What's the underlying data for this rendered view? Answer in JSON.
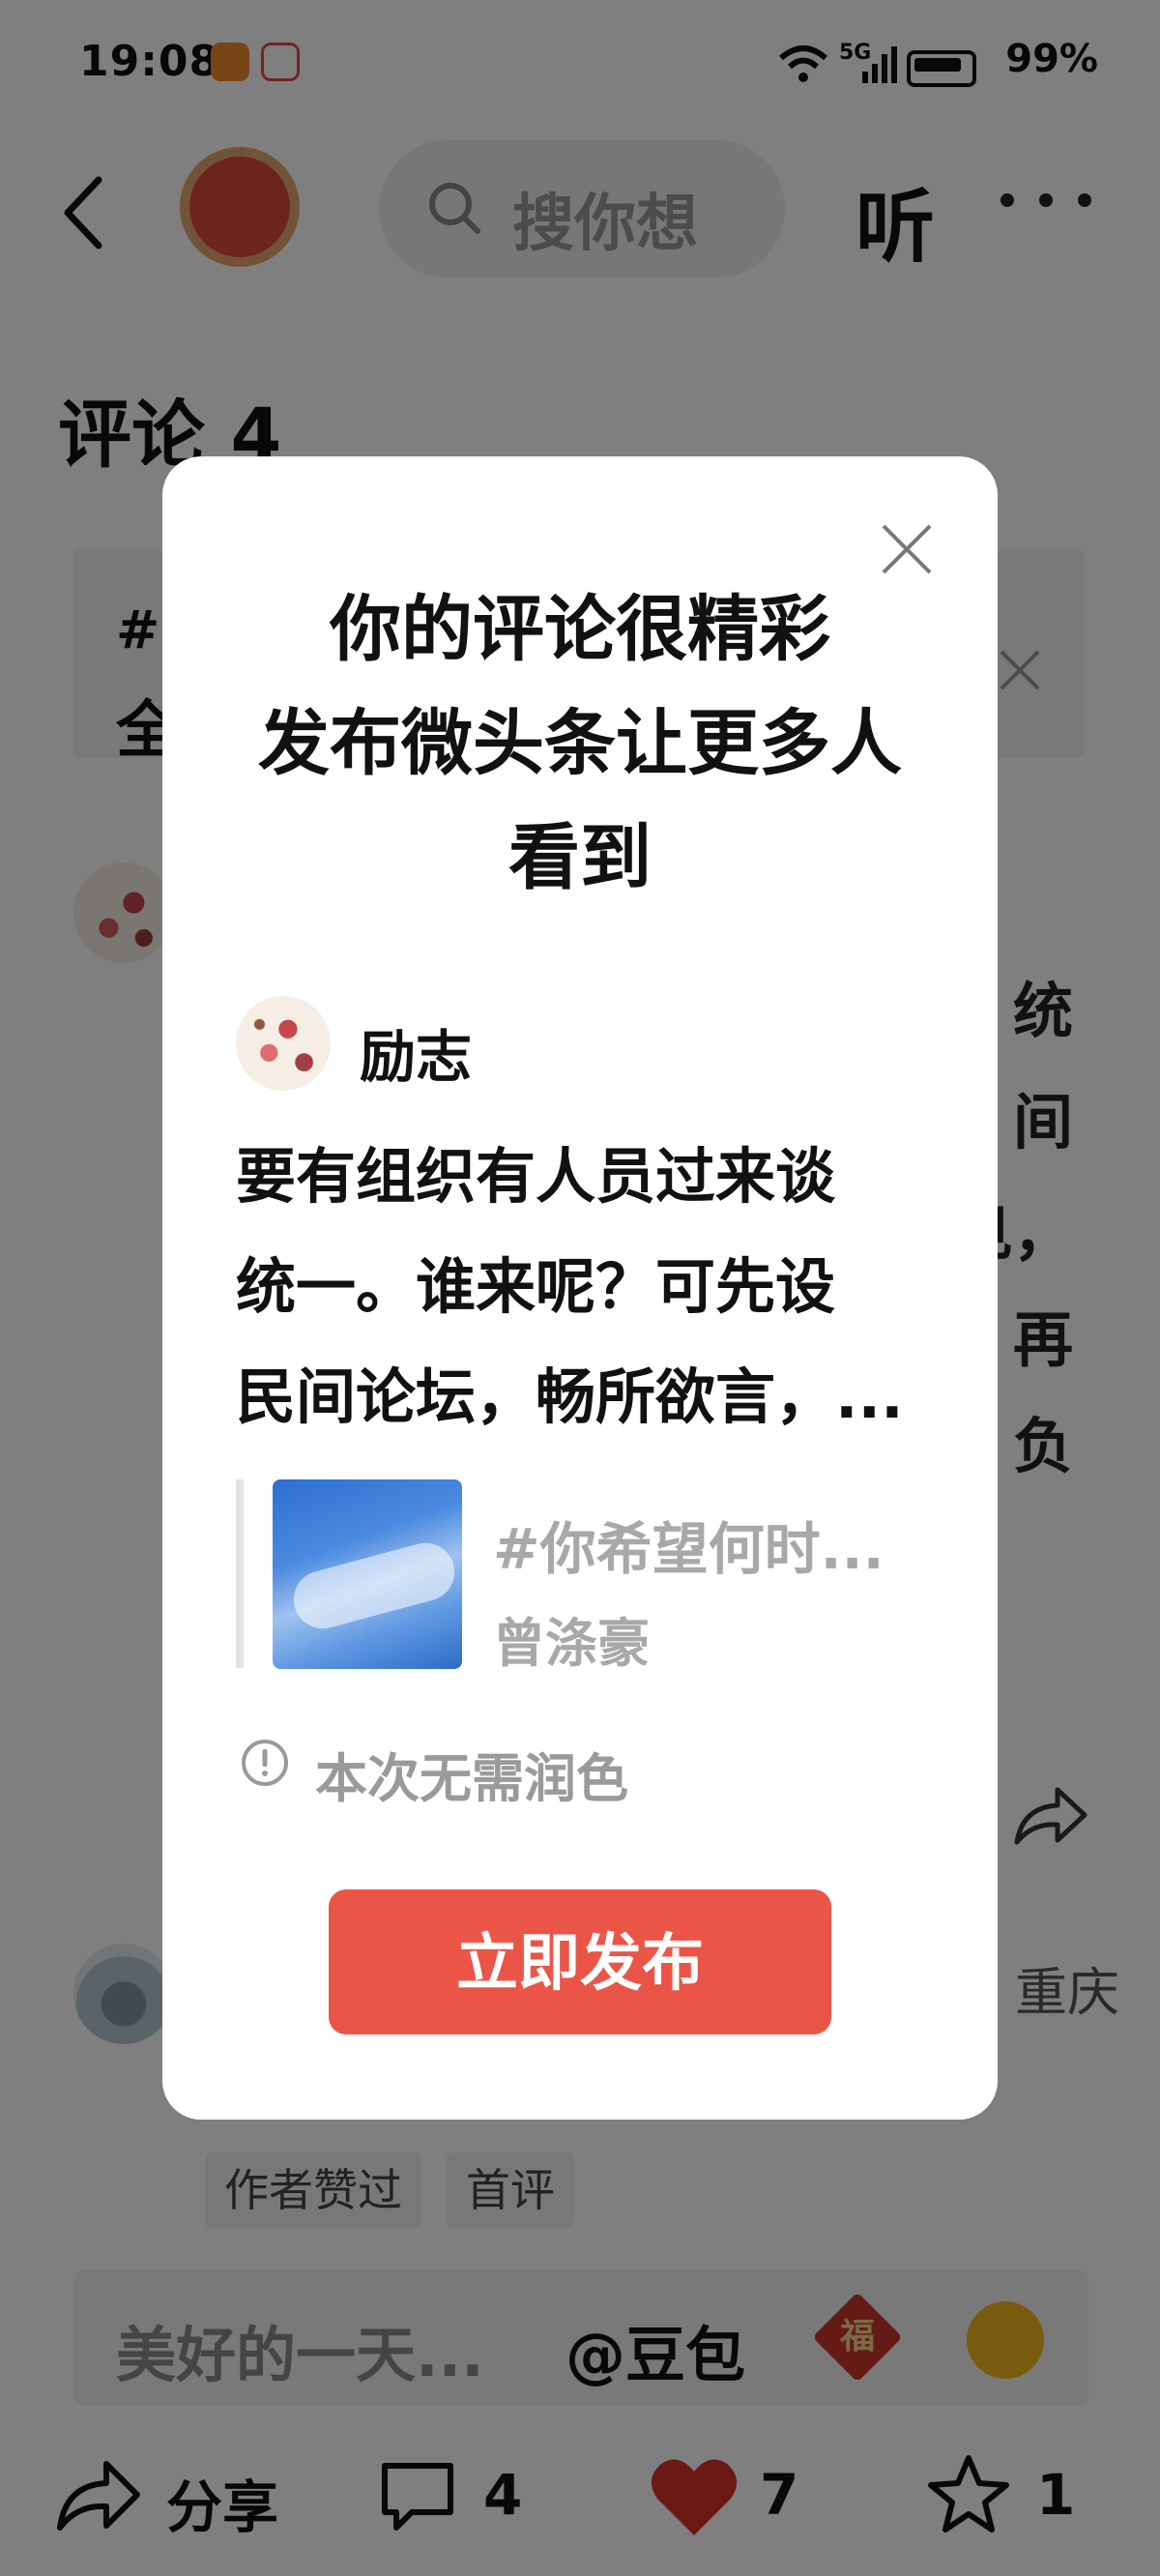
{
  "status_bar": {
    "time": "19:08",
    "network": "5G",
    "battery": "99%"
  },
  "top_nav": {
    "search_placeholder": "搜你想",
    "listen_label": "听"
  },
  "comments": {
    "heading": "评论 4"
  },
  "banner": {
    "icon_text": "#",
    "text": "全"
  },
  "background_comment": {
    "right_chars": [
      "统",
      "间",
      "见，",
      "再",
      "负"
    ]
  },
  "second_comment": {
    "location": "重庆",
    "tags": [
      "作者赞过",
      "首评"
    ]
  },
  "input_bar": {
    "placeholder": "美好的一天...",
    "mention": "@豆包",
    "fu_char": "福"
  },
  "actions": {
    "share_label": "分享",
    "comment_count": "4",
    "like_count": "7",
    "star_count": "1"
  },
  "modal": {
    "title_lines": [
      "你的评论很精彩",
      "发布微头条让更多人",
      "看到"
    ],
    "author_name": "励志",
    "comment_lines": [
      "要有组织有人员过来谈",
      "统一。谁来呢？可先设",
      "民间论坛，畅所欲言，..."
    ],
    "quote_topic": "#你希望何时...",
    "quote_author": "曾涤豪",
    "notice": "本次无需润色",
    "publish_label": "立即发布"
  },
  "colors": {
    "accent_red": "#eb5547",
    "like_red": "#d9302c",
    "overlay": "rgba(0,0,0,0.5)"
  }
}
